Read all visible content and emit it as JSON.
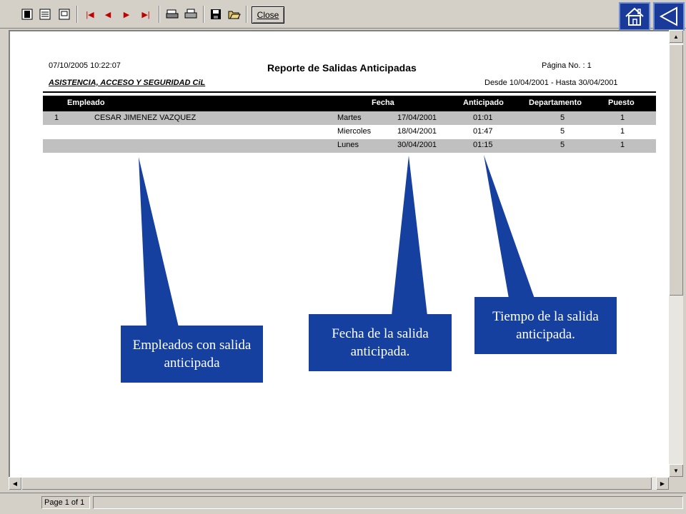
{
  "toolbar": {
    "icons": [
      "fit-page-icon",
      "whole-page-icon",
      "zoom-icon",
      "first-page-icon",
      "prev-page-icon",
      "next-page-icon",
      "last-page-icon",
      "print-setup-icon",
      "print-icon",
      "save-icon",
      "open-icon"
    ],
    "close_label": "Close"
  },
  "report": {
    "datetime": "07/10/2005 10:22:07",
    "title": "Reporte de Salidas Anticipadas",
    "page_label": "Página No. : 1",
    "company": "ASISTENCIA, ACCESO Y SEGURIDAD CiL",
    "range": "Desde 10/04/2001 - Hasta 30/04/2001",
    "columns": {
      "empleado": "Empleado",
      "fecha": "Fecha",
      "anticipado": "Anticipado",
      "departamento": "Departamento",
      "puesto": "Puesto"
    },
    "employee": {
      "id": "1",
      "name": "CESAR JIMENEZ VAZQUEZ"
    },
    "rows": [
      {
        "dia": "Martes",
        "fecha": "17/04/2001",
        "anticipado": "01:01",
        "departamento": "5",
        "puesto": "1"
      },
      {
        "dia": "Miercoles",
        "fecha": "18/04/2001",
        "anticipado": "01:47",
        "departamento": "5",
        "puesto": "1"
      },
      {
        "dia": "Lunes",
        "fecha": "30/04/2001",
        "anticipado": "01:15",
        "departamento": "5",
        "puesto": "1"
      }
    ]
  },
  "callouts": {
    "empleados": "Empleados con salida anticipada",
    "fecha": "Fecha de la salida anticipada.",
    "tiempo": "Tiempo de la salida anticipada."
  },
  "status": {
    "page": "Page 1 of 1"
  },
  "colors": {
    "callout_blue": "#1540a0",
    "background": "#1f3f8c",
    "row_gray": "#c0c0c0"
  }
}
